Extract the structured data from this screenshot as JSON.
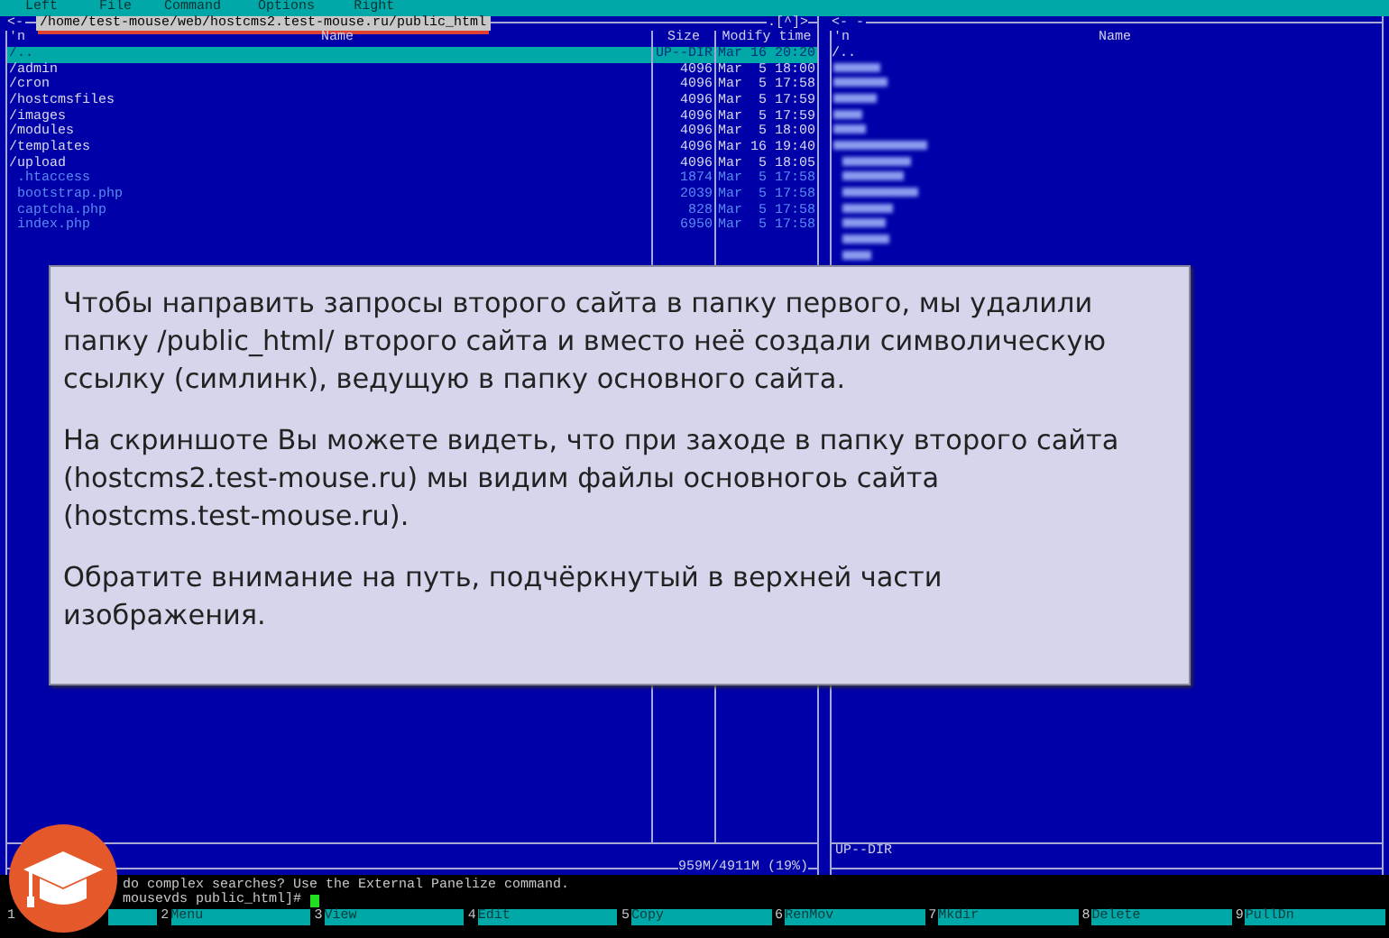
{
  "menu": [
    {
      "label": "Left"
    },
    {
      "label": "File"
    },
    {
      "label": "Command"
    },
    {
      "label": "Options"
    },
    {
      "label": "Right"
    }
  ],
  "left_panel": {
    "corner_left": "<-",
    "path": "/home/test-mouse/web/hostcms2.test-mouse.ru/public_html",
    "path_underlined": true,
    "corner_right": ".[^]>",
    "sort_mark": "'n",
    "columns": [
      "Name",
      "Size",
      "Modify time"
    ],
    "rows": [
      {
        "name": "/..",
        "size": "UP--DIR",
        "time": "Mar 16 20:20",
        "kind": "dir",
        "selected": true
      },
      {
        "name": "/admin",
        "size": "4096",
        "time": "Mar  5 18:00",
        "kind": "dir",
        "selected": false
      },
      {
        "name": "/cron",
        "size": "4096",
        "time": "Mar  5 17:58",
        "kind": "dir",
        "selected": false
      },
      {
        "name": "/hostcmsfiles",
        "size": "4096",
        "time": "Mar  5 17:59",
        "kind": "dir",
        "selected": false
      },
      {
        "name": "/images",
        "size": "4096",
        "time": "Mar  5 17:59",
        "kind": "dir",
        "selected": false
      },
      {
        "name": "/modules",
        "size": "4096",
        "time": "Mar  5 18:00",
        "kind": "dir",
        "selected": false
      },
      {
        "name": "/templates",
        "size": "4096",
        "time": "Mar 16 19:40",
        "kind": "dir",
        "selected": false
      },
      {
        "name": "/upload",
        "size": "4096",
        "time": "Mar  5 18:05",
        "kind": "dir",
        "selected": false
      },
      {
        "name": " .htaccess",
        "size": "1874",
        "time": "Mar  5 17:58",
        "kind": "file",
        "selected": false
      },
      {
        "name": " bootstrap.php",
        "size": "2039",
        "time": "Mar  5 17:58",
        "kind": "file",
        "selected": false
      },
      {
        "name": " captcha.php",
        "size": "828",
        "time": "Mar  5 17:58",
        "kind": "file",
        "selected": false
      },
      {
        "name": " index.php",
        "size": "6950",
        "time": "Mar  5 17:58",
        "kind": "file",
        "selected": false
      }
    ],
    "status": "959M/4911M (19%)"
  },
  "right_panel": {
    "corner_left": "<- -",
    "sort_mark": "'n",
    "columns": [
      "Name"
    ],
    "rows": [
      {
        "name": "/..",
        "kind": "dir",
        "selected": false
      }
    ],
    "blurred_entries": [
      {
        "kind": "dir"
      },
      {
        "kind": "dir"
      },
      {
        "kind": "dir"
      },
      {
        "kind": "dir"
      },
      {
        "kind": "dir"
      },
      {
        "kind": "dir"
      },
      {
        "kind": "file"
      },
      {
        "kind": "file"
      },
      {
        "kind": "file"
      },
      {
        "kind": "file"
      },
      {
        "kind": "file"
      },
      {
        "kind": "file"
      },
      {
        "kind": "file"
      }
    ],
    "mini_status": "UP--DIR"
  },
  "command_line": {
    "hint": "do complex searches? Use the External Panelize command.",
    "prompt": "mousevds public_html]#"
  },
  "function_keys": [
    {
      "number": "1"
    },
    {
      "number": "2",
      "label": "Menu"
    },
    {
      "number": "3",
      "label": "View"
    },
    {
      "number": "4",
      "label": "Edit"
    },
    {
      "number": "5",
      "label": "Copy"
    },
    {
      "number": "6",
      "label": "RenMov"
    },
    {
      "number": "7",
      "label": "Mkdir"
    },
    {
      "number": "8",
      "label": "Delete"
    },
    {
      "number": "9",
      "label": "PullDn"
    }
  ],
  "note": {
    "paragraphs": [
      "Чтобы направить запросы второго сайта в папку первого, мы удалили папку /public_html/ второго сайта и вместо неё создали символическую ссылку (симлинк), ведущую в папку основного сайта.",
      "На скриншоте Вы можете видеть, что при заходе в папку второго сайта (hostcms2.test-mouse.ru) мы видим файлы основногоь сайта (hostcms.test-mouse.ru).",
      "Обратите внимание на путь, подчёркнутый в верхней части изображения."
    ]
  }
}
